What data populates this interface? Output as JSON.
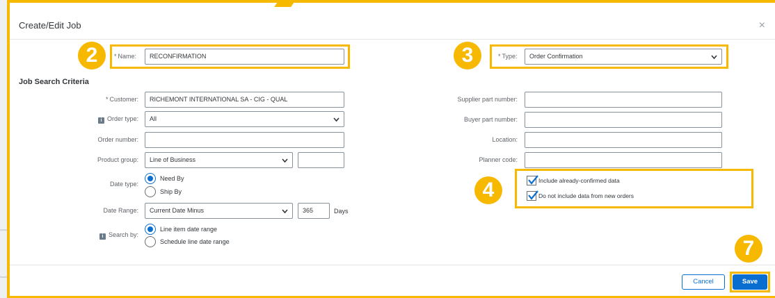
{
  "dialog": {
    "title": "Create/Edit Job",
    "close_glyph": "×"
  },
  "name_field": {
    "label": "Name:",
    "required_mark": "*",
    "value": "RECONFIRMATION"
  },
  "type_field": {
    "label": "Type:",
    "required_mark": "*",
    "value": "Order Confirmation"
  },
  "section": {
    "title": "Job Search Criteria"
  },
  "left_fields": {
    "customer": {
      "label": "Customer:",
      "required_mark": "*",
      "value": "RICHEMONT INTERNATIONAL SA - CIG - QUAL"
    },
    "order_type": {
      "label": "Order type:",
      "value": "All"
    },
    "order_number": {
      "label": "Order number:",
      "value": ""
    },
    "product_group": {
      "label": "Product group:",
      "value": "Line of Business",
      "extra_value": ""
    },
    "date_type": {
      "label": "Date type:",
      "options": [
        "Need By",
        "Ship By"
      ],
      "selected": "Need By"
    },
    "date_range": {
      "label": "Date Range:",
      "value": "Current Date Minus",
      "number": "365",
      "unit": "Days"
    },
    "search_by": {
      "label": "Search by:",
      "options": [
        "Line item date range",
        "Schedule line date range"
      ],
      "selected": "Line item date range"
    }
  },
  "right_fields": {
    "supplier_part": {
      "label": "Supplier part number:",
      "value": ""
    },
    "buyer_part": {
      "label": "Buyer part number:",
      "value": ""
    },
    "location": {
      "label": "Location:",
      "value": ""
    },
    "planner_code": {
      "label": "Planner code:",
      "value": ""
    }
  },
  "checkboxes": [
    {
      "label": "Include already-confirmed data",
      "checked": true
    },
    {
      "label": "Do not include data from new orders",
      "checked": true
    }
  ],
  "footer": {
    "cancel_label": "Cancel",
    "save_label": "Save"
  },
  "callouts": {
    "name": "2",
    "type": "3",
    "checkboxes": "4",
    "save": "7"
  },
  "colors": {
    "highlight": "#f7b800",
    "accent": "#0a6ed1",
    "badge_text": "#ffffff"
  },
  "icons": {
    "info": "info-icon",
    "close": "close-icon",
    "dropdown": "chevron-down-icon",
    "check": "checkmark-icon"
  }
}
